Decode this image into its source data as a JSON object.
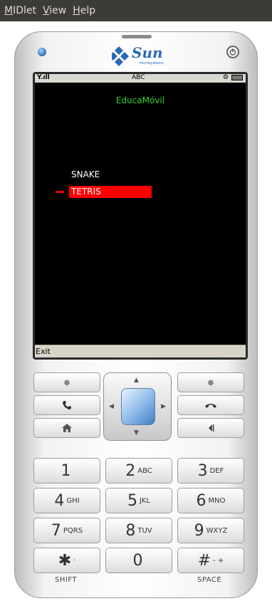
{
  "menubar": {
    "items": [
      {
        "first": "M",
        "rest": "IDlet"
      },
      {
        "first": "V",
        "rest": "iew"
      },
      {
        "first": "H",
        "rest": "elp"
      }
    ]
  },
  "device": {
    "brand": "Sun",
    "brand_sub": "microsystems",
    "power_icon": "power-icon"
  },
  "statusbar": {
    "signal": "Y.ıll",
    "input_mode": "ABC"
  },
  "app": {
    "title": "EducaMóvil",
    "menu_items": [
      "SNAKE",
      "TETRIS"
    ],
    "selected_index": 1,
    "softkey_left": "Exit"
  },
  "keypad": {
    "keys": [
      {
        "digit": "1",
        "letters": ""
      },
      {
        "digit": "2",
        "letters": "ABC"
      },
      {
        "digit": "3",
        "letters": "DEF"
      },
      {
        "digit": "4",
        "letters": "GHI"
      },
      {
        "digit": "5",
        "letters": "JKL"
      },
      {
        "digit": "6",
        "letters": "MNO"
      },
      {
        "digit": "7",
        "letters": "PQRS"
      },
      {
        "digit": "8",
        "letters": "TUV"
      },
      {
        "digit": "9",
        "letters": "WXYZ"
      },
      {
        "digit": "✱",
        "letters": "·"
      },
      {
        "digit": "0",
        "letters": ""
      },
      {
        "digit": "#",
        "letters": "- +"
      }
    ],
    "label_shift": "SHIFT",
    "label_space": "SPACE"
  },
  "colors": {
    "title_green": "#2fd52f",
    "selection_red": "#ff0000",
    "menubar_bg": "#3c3b37"
  }
}
